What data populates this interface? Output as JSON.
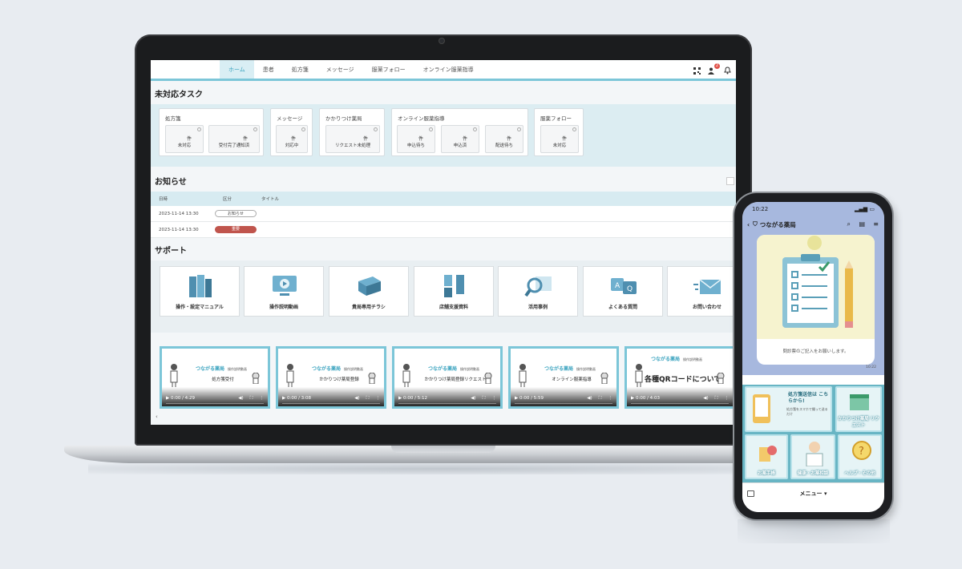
{
  "nav": {
    "tabs": [
      "ホーム",
      "患者",
      "処方箋",
      "メッセージ",
      "服薬フォロー",
      "オンライン服薬指導"
    ],
    "icons": [
      "qr-code-icon",
      "user-add-icon",
      "bell-icon"
    ],
    "badge": "2"
  },
  "tasks": {
    "title": "未対応タスク",
    "count_unit": "件",
    "groups": [
      {
        "label": "処方箋",
        "items": [
          "未対応",
          "受付完了通知済"
        ]
      },
      {
        "label": "メッセージ",
        "items": [
          "対応中"
        ]
      },
      {
        "label": "かかりつけ薬局",
        "items": [
          "リクエスト未処理"
        ]
      },
      {
        "label": "オンライン服薬指導",
        "items": [
          "申込待ち",
          "申込済",
          "配送待ち"
        ]
      },
      {
        "label": "服薬フォロー",
        "items": [
          "未対応"
        ]
      }
    ]
  },
  "news": {
    "title": "お知らせ",
    "columns": [
      "日時",
      "区分",
      "タイトル"
    ],
    "rows": [
      {
        "date": "2023-11-14 13:30",
        "category": "お知らせ",
        "title": ""
      },
      {
        "date": "2023-11-14 13:30",
        "category": "重要",
        "title": ""
      }
    ]
  },
  "support": {
    "title": "サポート",
    "items": [
      "操作・設定マニュアル",
      "操作説明動画",
      "貴局専用チラシ",
      "店舗支援資料",
      "活用事例",
      "よくある質問",
      "お問い合わせ"
    ]
  },
  "videos": [
    {
      "title": "処方箋受付",
      "time": "0:00 / 4:29"
    },
    {
      "title": "かかりつけ薬局登録",
      "time": "0:00 / 3:08"
    },
    {
      "title": "かかりつけ薬局登録リクエスト",
      "time": "0:00 / 5:12"
    },
    {
      "title": "オンライン服薬指導",
      "time": "0:00 / 5:59"
    },
    {
      "title": "各種QRコードについて",
      "time": "0:00 / 4:03"
    }
  ],
  "video_brand": "つながる薬局",
  "video_brand_sub": "操作説明動画",
  "phone": {
    "time": "10:22",
    "chat_title": "つながる薬局",
    "caption": "問診票のご記入をお願いします。",
    "msg_time": "10:22",
    "tiles": [
      "処方箋送信は こちらから!",
      "かかりつけ薬局 リクエスト",
      "お薬手帳",
      "健康・お薬相談",
      "ヘルプ・その他"
    ],
    "tile_note": "処方箋をスマホで撮って送るだけ",
    "menu_label": "メニュー ▾"
  },
  "colors": {
    "accent": "#7cc6d8",
    "danger": "#c0554d",
    "phone_bg": "#a7b8de",
    "menu_bg": "#68b5c4"
  }
}
